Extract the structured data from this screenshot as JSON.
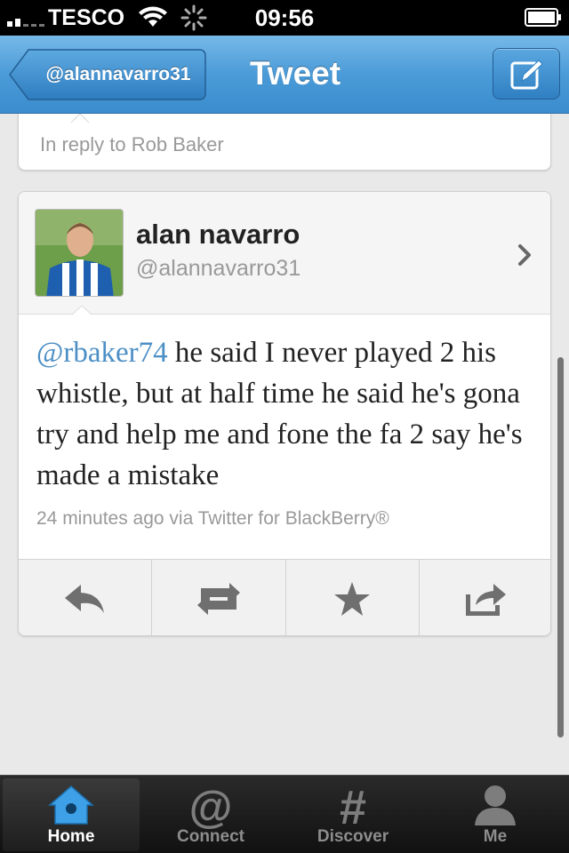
{
  "status_bar": {
    "carrier": "TESCO",
    "time": "09:56"
  },
  "navbar": {
    "back_label": "@alannavarro31",
    "title": "Tweet",
    "compose_icon": "compose-icon"
  },
  "reply": {
    "text": "In reply to Rob Baker"
  },
  "tweet": {
    "display_name": "alan navarro",
    "handle": "@alannavarro31",
    "mention": "@rbaker74",
    "body": " he said I never played 2 his whistle, but at half time he said he's gona try and help me and fone the fa 2 say he's made a mistake",
    "meta": "24 minutes ago via Twitter for BlackBerry®",
    "mention_color": "#4c8fc5"
  },
  "actions": [
    {
      "name": "reply",
      "icon": "reply-icon"
    },
    {
      "name": "retweet",
      "icon": "retweet-icon"
    },
    {
      "name": "favorite",
      "icon": "star-icon"
    },
    {
      "name": "share",
      "icon": "share-icon"
    }
  ],
  "tabbar": {
    "tabs": [
      {
        "label": "Home",
        "icon": "home-icon",
        "active": true
      },
      {
        "label": "Connect",
        "icon": "at-icon",
        "active": false
      },
      {
        "label": "Discover",
        "icon": "hash-icon",
        "active": false
      },
      {
        "label": "Me",
        "icon": "person-icon",
        "active": false
      }
    ],
    "active_color": "#ffffff",
    "home_icon_color": "#3ea0e6"
  }
}
